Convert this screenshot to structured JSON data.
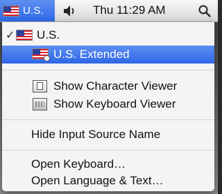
{
  "menubar": {
    "input_label": "U.S.",
    "clock": "Thu 11:29 AM",
    "icons": {
      "input_flag": "us-flag-icon",
      "volume": "volume-icon",
      "spotlight": "search-icon"
    }
  },
  "menu": {
    "sources": [
      {
        "label": "U.S.",
        "checked": true,
        "icon": "us-flag-icon"
      },
      {
        "label": "U.S. Extended",
        "highlighted": true,
        "icon": "us-extended-flag-icon"
      }
    ],
    "viewers": [
      {
        "label": "Show Character Viewer",
        "icon": "character-viewer-icon"
      },
      {
        "label": "Show Keyboard Viewer",
        "icon": "keyboard-viewer-icon"
      }
    ],
    "hide_name": "Hide Input Source Name",
    "open_keyboard": "Open Keyboard…",
    "open_language": "Open Language & Text…",
    "check_mark": "✓"
  },
  "colors": {
    "selection": "#2e66e6",
    "menu_background": "#f4f4f4",
    "menubar_active": "#2d68e8"
  }
}
